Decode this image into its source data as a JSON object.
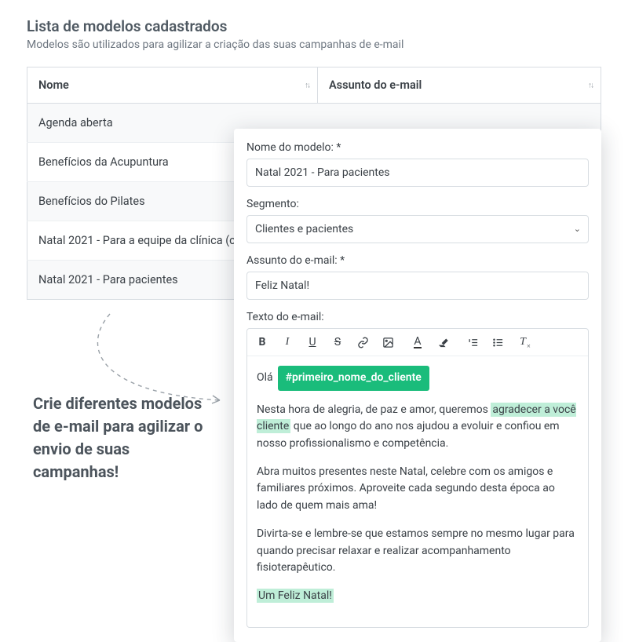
{
  "header": {
    "title": "Lista de modelos cadastrados",
    "subtitle": "Modelos são utilizados para agilizar a criação das suas campanhas de e-mail"
  },
  "table": {
    "columns": {
      "name": "Nome",
      "subject": "Assunto do e-mail"
    },
    "rows": [
      {
        "name": "Agenda aberta"
      },
      {
        "name": "Benefícios da Acupuntura"
      },
      {
        "name": "Benefícios do Pilates"
      },
      {
        "name": "Natal 2021 - Para a equipe da clínica (c"
      },
      {
        "name": "Natal 2021 - Para pacientes"
      }
    ]
  },
  "callout": "Crie diferentes modelos de e-mail para agilizar o envio de suas campanhas!",
  "panel": {
    "labels": {
      "model_name": "Nome do modelo: *",
      "segment": "Segmento:",
      "subject": "Assunto do e-mail: *",
      "body": "Texto do e-mail:"
    },
    "model_name": "Natal 2021 - Para pacientes",
    "segment_selected": "Clientes e pacientes",
    "subject": "Feliz Natal!",
    "body": {
      "greeting_prefix": "Olá",
      "tag": "#primeiro_nome_do_cliente",
      "p1_a": "Nesta hora de alegria, de paz e amor, queremos ",
      "p1_hl1": "agradecer a você cliente",
      "p1_b": " que ao longo do ano nos ajudou a evoluir e confiou em nosso profissionalismo e competência.",
      "p2": "Abra muitos presentes neste Natal, celebre com os amigos e familiares próximos. Aproveite cada segundo desta época ao lado de quem mais ama!",
      "p3": "Divirta-se e lembre-se que estamos sempre no mesmo lugar para quando precisar relaxar e realizar acompanhamento fisioterapêutico.",
      "p4_hl": "Um Feliz Natal!"
    }
  }
}
